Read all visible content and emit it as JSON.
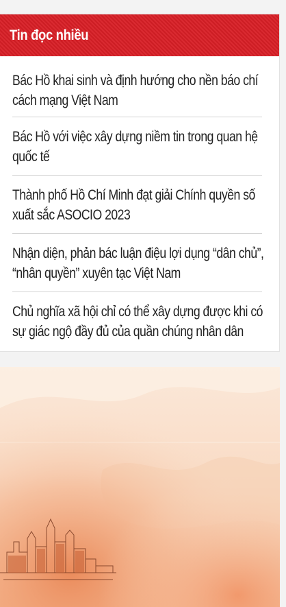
{
  "widget": {
    "title": "Tin đọc nhiều",
    "header_color": "#d81f26",
    "items": [
      {
        "lines": [
          "Bác Hồ khai sinh và định hướng cho nền báo chí",
          "cách mạng Việt Nam"
        ]
      },
      {
        "lines": [
          "Bác Hồ với việc xây dựng niềm tin trong quan hệ",
          "quốc tế"
        ]
      },
      {
        "lines": [
          "Thành phố Hồ Chí Minh đạt giải Chính quyền số",
          "xuất sắc ASOCIO 2023"
        ]
      },
      {
        "lines": [
          "Nhận diện, phản bác luận điệu lợi dụng “dân chủ”,",
          "“nhân quyền” xuyên tạc Việt Nam"
        ]
      },
      {
        "lines": [
          "Chủ nghĩa xã hội chỉ có thể xây dựng được khi có",
          "sự giác ngộ đầy đủ của quần chúng nhân dân"
        ]
      }
    ]
  },
  "banner": {
    "description_icon": "city-watercolor-illustration",
    "colors": {
      "light": "#fbe8d9",
      "mid": "#f6c9a9",
      "deep": "#e8814f",
      "ink": "#7a3b22"
    }
  }
}
